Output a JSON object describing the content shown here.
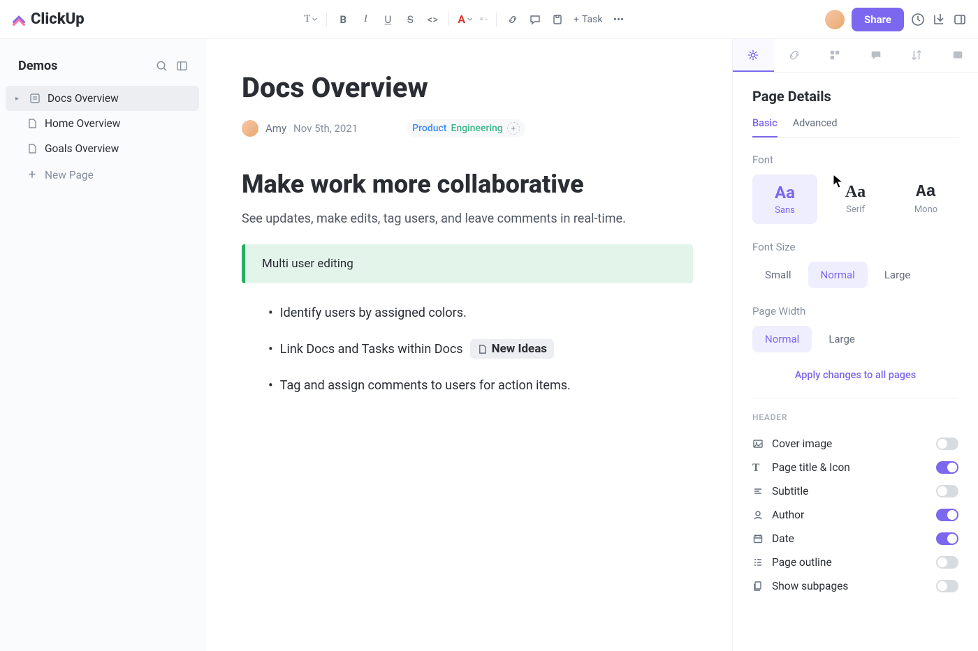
{
  "brand": "ClickUp",
  "topbar": {
    "add_task": "Task",
    "share": "Share"
  },
  "sidebar": {
    "title": "Demos",
    "items": [
      {
        "label": "Docs Overview",
        "active": true
      },
      {
        "label": "Home Overview",
        "active": false
      },
      {
        "label": "Goals Overview",
        "active": false
      }
    ],
    "new_page": "New Page"
  },
  "doc": {
    "title": "Docs Overview",
    "author": "Amy",
    "date": "Nov 5th, 2021",
    "tags": {
      "product": "Product",
      "engineering": "Engineering"
    },
    "heading": "Make work more collaborative",
    "paragraph": "See updates, make edits, tag users, and leave comments in real-time.",
    "callout": "Multi user editing",
    "list": {
      "item1": "Identify users by assigned colors.",
      "item2": "Link Docs and Tasks within Docs",
      "item2_chip": "New Ideas",
      "item3": "Tag and assign comments to users for action items."
    }
  },
  "panel": {
    "title": "Page Details",
    "subtabs": {
      "basic": "Basic",
      "advanced": "Advanced"
    },
    "font_label": "Font",
    "fonts": {
      "sans": "Sans",
      "serif": "Serif",
      "mono": "Mono"
    },
    "font_demo": "Aa",
    "fontsize_label": "Font Size",
    "sizes": {
      "small": "Small",
      "normal": "Normal",
      "large": "Large"
    },
    "width_label": "Page Width",
    "widths": {
      "normal": "Normal",
      "large": "Large"
    },
    "apply": "Apply changes to all pages",
    "header_section": "HEADER",
    "toggles": {
      "cover": "Cover image",
      "title_icon": "Page title & Icon",
      "subtitle": "Subtitle",
      "author": "Author",
      "date": "Date",
      "outline": "Page outline",
      "subpages": "Show subpages"
    }
  }
}
